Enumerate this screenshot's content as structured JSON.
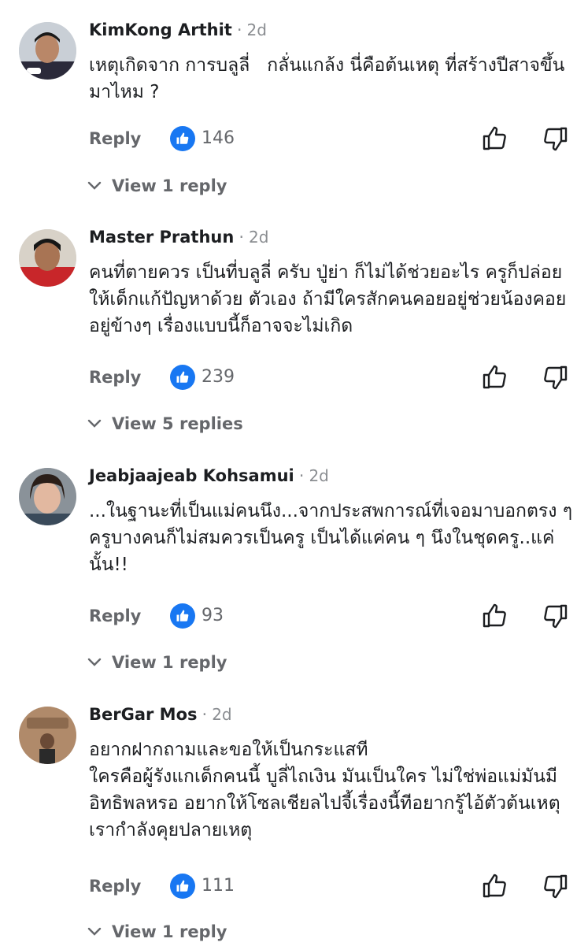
{
  "comments": [
    {
      "name": "KimKong Arthit",
      "separator": "·",
      "time": "2d",
      "body": "เหตุเกิดจาก การบลูลี่   กลั่นแกล้ง นี่คือต้นเหตุ ที่สร้างปีสาจขึ้นมาไหม ?",
      "reply_label": "Reply",
      "likes": "146",
      "view_replies": "View 1 reply"
    },
    {
      "name": "Master Prathun",
      "separator": "·",
      "time": "2d",
      "body": "คนที่ตายควร เป็นที่บลูลี่ ครับ ปู่ย่า ก็ไม่ได้ช่วยอะไร ครูก็ปล่อย ให้เด็กแก้ปัญหาด้วย ตัวเอง ถ้ามีใครสักคนคอยอยู่ช่วยน้องคอยอยู่ข้างๆ เรื่องแบบนี้ก็อาจจะไม่เกิด",
      "reply_label": "Reply",
      "likes": "239",
      "view_replies": "View 5 replies"
    },
    {
      "name": "Jeabjaajeab Kohsamui",
      "separator": "·",
      "time": "2d",
      "body": "...ในฐานะที่เป็นแม่คนนึง...จากประสพการณ์ที่เจอมาบอกตรง ๆ ครูบางคนก็ไม่สมควรเป็นครู เป็นได้แค่คน ๆ นึงในชุดครู..แค่นั้น!!",
      "reply_label": "Reply",
      "likes": "93",
      "view_replies": "View 1 reply"
    },
    {
      "name": "BerGar Mos",
      "separator": "·",
      "time": "2d",
      "body": "อยากฝากถามและขอให้เป็นกระแสที\nใครคือผู้รังแกเด็กคนนี้ บูลี่ไถเงิน มันเป็นใคร ไม่ใช่พ่อแม่มันมีอิทธิพลหรอ อยากให้โซลเชียลไปจี้เรื่องนี้ทีอยากรู้ไอ้ตัวต้นเหตุเรากำลังคุยปลายเหตุ",
      "reply_label": "Reply",
      "likes": "111",
      "view_replies": "View 1 reply"
    }
  ],
  "colors": {
    "text": "#1c1e21",
    "secondary": "#65676b",
    "meta": "#8a8d91",
    "like_blue": "#1877f2"
  },
  "icons": {
    "like_badge": "thumbs-up-icon",
    "upvote": "thumb-up-outline-icon",
    "downvote": "thumb-down-outline-icon",
    "expand": "chevron-down-icon"
  }
}
